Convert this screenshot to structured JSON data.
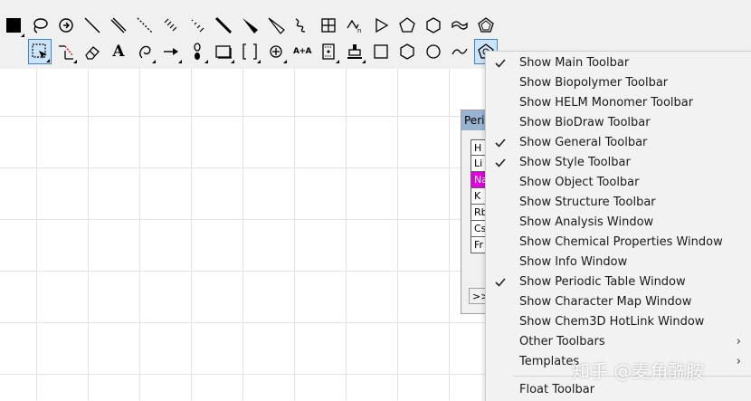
{
  "menu": {
    "items": [
      {
        "label": "Show Main Toolbar",
        "checked": true
      },
      {
        "label": "Show Biopolymer Toolbar",
        "checked": false
      },
      {
        "label": "Show HELM Monomer Toolbar",
        "checked": false
      },
      {
        "label": "Show BioDraw Toolbar",
        "checked": false
      },
      {
        "label": "Show General Toolbar",
        "checked": true
      },
      {
        "label": "Show Style Toolbar",
        "checked": true
      },
      {
        "label": "Show Object Toolbar",
        "checked": false
      },
      {
        "label": "Show Structure Toolbar",
        "checked": false
      },
      {
        "label": "Show Analysis Window",
        "checked": false
      },
      {
        "label": "Show Chemical Properties Window",
        "checked": false
      },
      {
        "label": "Show Info Window",
        "checked": false
      },
      {
        "label": "Show Periodic Table Window",
        "checked": true
      },
      {
        "label": "Show Character Map Window",
        "checked": false
      },
      {
        "label": "Show Chem3D HotLink Window",
        "checked": false
      },
      {
        "label": "Other Toolbars",
        "checked": false,
        "submenu": true
      },
      {
        "label": "Templates",
        "checked": false,
        "submenu": true
      },
      {
        "label": "Float Toolbar",
        "checked": false
      }
    ],
    "submenu_glyph": "›"
  },
  "periodic_table": {
    "title": "Peri",
    "cells": [
      "H",
      "Li",
      "Na",
      "K",
      "Rb",
      "Cs",
      "Fr"
    ],
    "highlighted": "Na",
    "more_label": ">>",
    "highlight_color": "#e000e0"
  },
  "toolbar": {
    "text_tool_label": "A",
    "mapping_tool_label": "A+A",
    "row1_icons": [
      "color-swatch-icon",
      "lasso-icon",
      "rotate-icon",
      "single-bond-icon",
      "double-bond-icon",
      "dashed-bond-icon",
      "hashed-bond-icon",
      "hashed-wedge-bond-icon",
      "bold-bond-icon",
      "wedge-bond-icon",
      "hashed-wedge-icon",
      "wavy-bond-icon",
      "grid-table-icon",
      "arrow-mechanism-icon",
      "triangle-ring-icon",
      "pentagon-ring-icon",
      "hexagon-ring-icon",
      "cyclopentadiene-icon",
      "benzene-ring-icon"
    ],
    "row2_icons": [
      "marquee-select-icon",
      "structure-perspective-icon",
      "eraser-icon",
      "text-icon",
      "pen-icon",
      "arrow-icon",
      "orbital-icon",
      "drawing-element-icon",
      "bracket-icon",
      "charge-symbol-icon",
      "atom-mapping-icon",
      "tlc-plate-icon",
      "lab-equipment-icon",
      "square-ring-icon",
      "hexagon-alt-icon",
      "circle-ring-icon",
      "wave-icon",
      "chain-template-icon"
    ]
  },
  "watermark": "知乎 @麦角酰胺",
  "colors": {
    "selection": "#cce4f7",
    "titlebar": "#99b4d1"
  }
}
